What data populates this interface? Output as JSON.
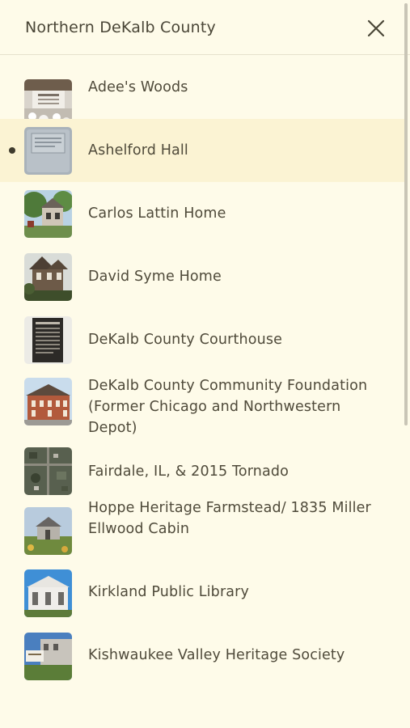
{
  "header": {
    "title": "Northern DeKalb County",
    "close_icon": "close-icon"
  },
  "list": {
    "selected_index": 1,
    "items": [
      {
        "label": "Adee's Woods",
        "thumb": "plaque-photo"
      },
      {
        "label": "Ashelford Hall",
        "thumb": "sign-photo"
      },
      {
        "label": "Carlos Lattin Home",
        "thumb": "house-trees-photo"
      },
      {
        "label": "David Syme Home",
        "thumb": "victorian-house-photo"
      },
      {
        "label": "DeKalb County Courthouse",
        "thumb": "historical-marker-photo"
      },
      {
        "label": "DeKalb County Community Foundation (Former Chicago and Northwestern Depot)",
        "thumb": "brick-building-photo"
      },
      {
        "label": "Fairdale, IL, & 2015 Tornado",
        "thumb": "aerial-photo"
      },
      {
        "label": "Hoppe Heritage Farmstead/ 1835 Miller Ellwood Cabin",
        "thumb": "cabin-photo"
      },
      {
        "label": "Kirkland Public Library",
        "thumb": "library-photo"
      },
      {
        "label": "Kishwaukee Valley Heritage Society",
        "thumb": "sign-building-photo"
      }
    ]
  },
  "colors": {
    "background": "#fefbe9",
    "selected_row": "#fbf3d3",
    "text": "#4f4a3a",
    "divider": "#e6e1cc"
  }
}
